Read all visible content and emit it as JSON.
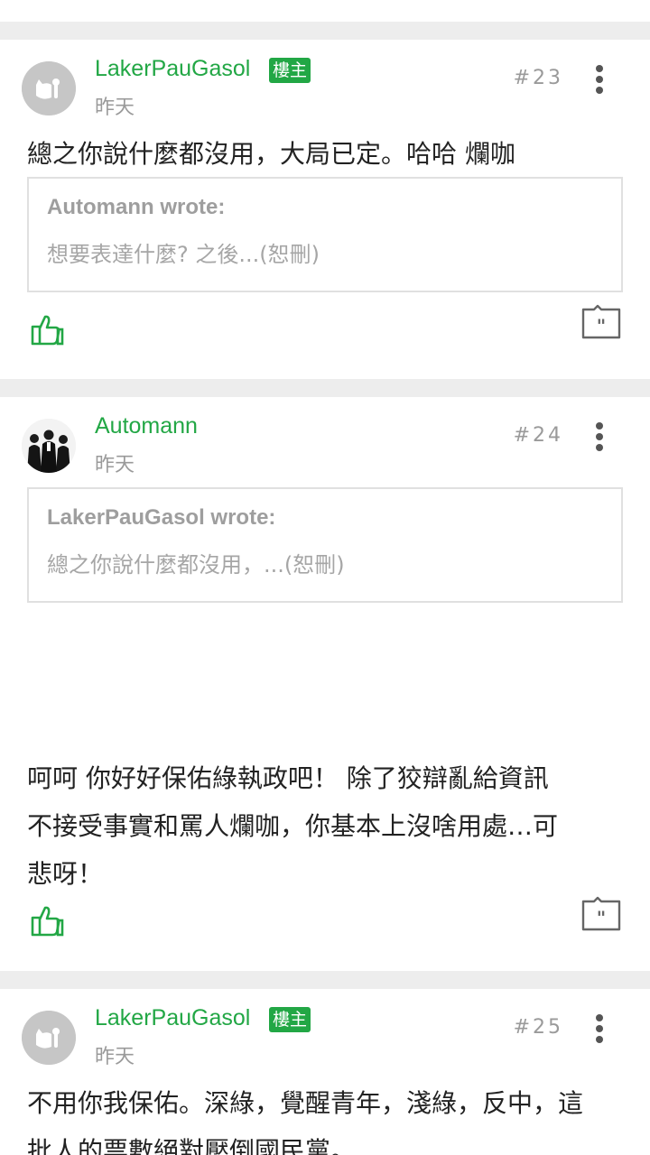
{
  "posts": [
    {
      "username": "LakerPauGasol",
      "badge": "樓主",
      "time": "昨天",
      "floor": "#23",
      "content": "總之你說什麼都沒用，大局已定。哈哈 爛咖",
      "quote": {
        "author": "Automann wrote:",
        "text": "想要表達什麼? 之後...(恕刪)"
      }
    },
    {
      "username": "Automann",
      "time": "昨天",
      "floor": "#24",
      "quote": {
        "author": "LakerPauGasol wrote:",
        "text": "總之你說什麼都沒用，...(恕刪)"
      },
      "content_lines": [
        "呵呵 你好好保佑綠執政吧！ 除了狡辯亂給資訊",
        "不接受事實和罵人爛咖，你基本上沒啥用處…可",
        "悲呀！"
      ]
    },
    {
      "username": "LakerPauGasol",
      "badge": "樓主",
      "time": "昨天",
      "floor": "#25",
      "content_lines": [
        "不用你我保佑。深綠，覺醒青年，淺綠，反中，這",
        "批人的票數絕對壓倒國民黨。"
      ]
    }
  ],
  "colors": {
    "accent": "#22a745",
    "meta": "#9a9a9a",
    "text": "#222222",
    "separator": "#ededed"
  },
  "icons": [
    "default-avatar-icon",
    "more-vertical-icon",
    "thumbs-up-icon",
    "quote-reply-icon"
  ]
}
